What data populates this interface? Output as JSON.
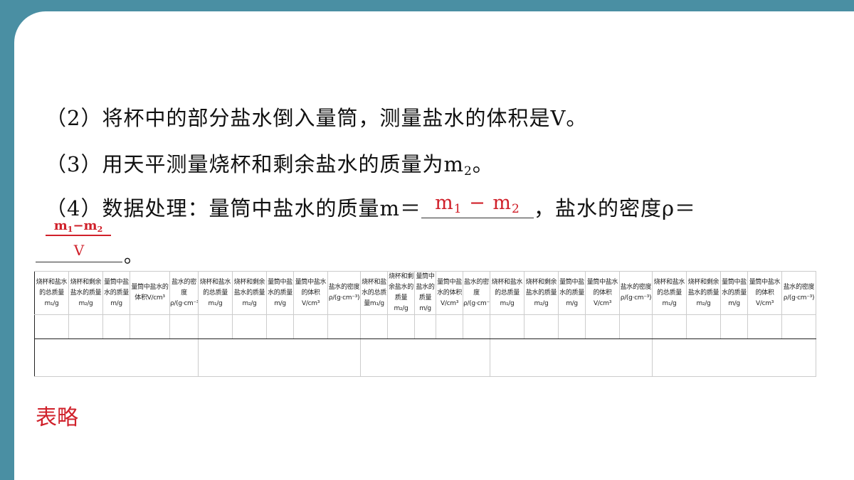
{
  "lines": {
    "step2": "（2）将杯中的部分盐水倒入量筒，测量盐水的体积是V。",
    "step3_prefix": "（3）用天平测量烧杯和剩余盐水的质量为m",
    "step3_sub": "2",
    "step3_suffix": "。",
    "step4_prefix": "（4）数据处理：量筒中盐水的质量m＝",
    "step4_mid": "，盐水的密度ρ＝",
    "step4_end": "。"
  },
  "answers": {
    "mass_m1": "m",
    "mass_sub1": "1",
    "mass_minus": " − ",
    "mass_m2": "m",
    "mass_sub2": "2",
    "density_num_m1": "m",
    "density_num_sub1": "1",
    "density_num_minus": "−",
    "density_num_m2": "m",
    "density_num_sub2": "2",
    "density_den": "V"
  },
  "table": {
    "groups": [
      [
        "烧杯和盐水的总质量m₁/g",
        "烧杯和剩余盐水的质量m₂/g",
        "量筒中盐水的质量m/g",
        "量筒中盐水的体积V/cm³",
        "盐水的密度ρ/(g·cm⁻³)"
      ],
      [
        "烧杯和盐水的总质量m₁/g",
        "烧杯和剩余盐水的质量m₂/g",
        "量筒中盐水的质量m/g",
        "量筒中盐水的体积V/cm³",
        "盐水的密度ρ/(g·cm⁻³)"
      ],
      [
        "烧杯和盐水的总质量m₁/g",
        "烧杯和剩余盐水的质量m₂/g",
        "量筒中盐水的质量m/g",
        "量筒中盐水的体积V/cm³",
        "盐水的密度ρ/(g·cm⁻³)"
      ],
      [
        "烧杯和盐水的总质量m₁/g",
        "烧杯和剩余盐水的质量m₂/g",
        "量筒中盐水的质量m/g",
        "量筒中盐水的体积V/cm³",
        "盐水的密度ρ/(g·cm⁻³)"
      ],
      [
        "烧杯和盐水的总质量m₁/g",
        "烧杯和剩余盐水的质量m₂/g",
        "量筒中盐水的质量m/g",
        "量筒中盐水的体积V/cm³",
        "盐水的密度ρ/(g·cm⁻³)"
      ]
    ]
  },
  "note": "表略",
  "colors": {
    "frame": "#4a8fa3",
    "answer": "#d0202a"
  }
}
